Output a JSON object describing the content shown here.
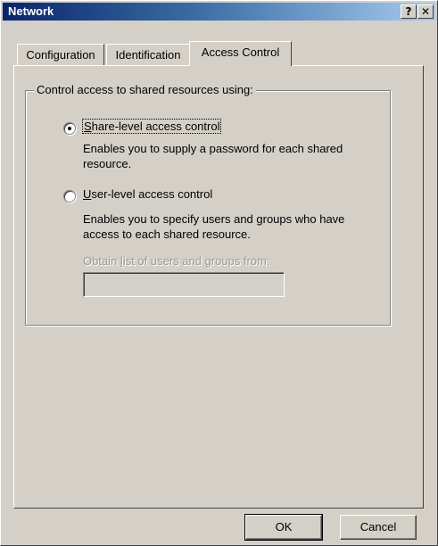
{
  "window": {
    "title": "Network",
    "help_button": "?",
    "close_button": "✕"
  },
  "tabs": [
    {
      "label": "Configuration",
      "active": false
    },
    {
      "label": "Identification",
      "active": false
    },
    {
      "label": "Access Control",
      "active": true
    }
  ],
  "group": {
    "label": "Control access to shared resources using:"
  },
  "share_level": {
    "selected": true,
    "mnemonic": "S",
    "label_rest": "hare-level access control",
    "description_line1": "Enables you to supply a password for each shared",
    "description_line2": "resource."
  },
  "user_level": {
    "selected": false,
    "mnemonic": "U",
    "label_rest": "ser-level access control",
    "description_line1": "Enables you to specify users and groups who have",
    "description_line2": "access to each shared resource.",
    "obtain_label_pre": "Obtain ",
    "obtain_mnemonic": "l",
    "obtain_label_post": "ist of users and groups from:",
    "obtain_value": ""
  },
  "buttons": {
    "ok": "OK",
    "cancel": "Cancel"
  }
}
